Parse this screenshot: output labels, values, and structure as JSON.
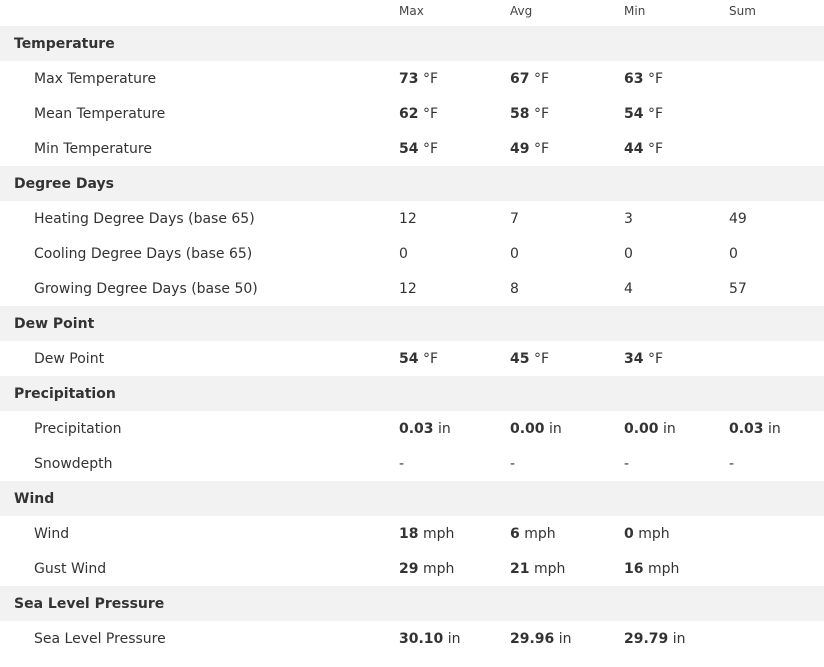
{
  "columns": {
    "max": "Max",
    "avg": "Avg",
    "min": "Min",
    "sum": "Sum"
  },
  "sections": [
    {
      "title": "Temperature",
      "rows": [
        {
          "label": "Max Temperature",
          "max": {
            "v": "73",
            "u": "°F",
            "b": true
          },
          "avg": {
            "v": "67",
            "u": "°F",
            "b": true
          },
          "min": {
            "v": "63",
            "u": "°F",
            "b": true
          },
          "sum": {
            "v": "",
            "u": "",
            "b": false
          }
        },
        {
          "label": "Mean Temperature",
          "max": {
            "v": "62",
            "u": "°F",
            "b": true
          },
          "avg": {
            "v": "58",
            "u": "°F",
            "b": true
          },
          "min": {
            "v": "54",
            "u": "°F",
            "b": true
          },
          "sum": {
            "v": "",
            "u": "",
            "b": false
          }
        },
        {
          "label": "Min Temperature",
          "max": {
            "v": "54",
            "u": "°F",
            "b": true
          },
          "avg": {
            "v": "49",
            "u": "°F",
            "b": true
          },
          "min": {
            "v": "44",
            "u": "°F",
            "b": true
          },
          "sum": {
            "v": "",
            "u": "",
            "b": false
          }
        }
      ]
    },
    {
      "title": "Degree Days",
      "rows": [
        {
          "label": "Heating Degree Days (base 65)",
          "max": {
            "v": "12",
            "u": "",
            "b": false
          },
          "avg": {
            "v": "7",
            "u": "",
            "b": false
          },
          "min": {
            "v": "3",
            "u": "",
            "b": false
          },
          "sum": {
            "v": "49",
            "u": "",
            "b": false
          }
        },
        {
          "label": "Cooling Degree Days (base 65)",
          "max": {
            "v": "0",
            "u": "",
            "b": false
          },
          "avg": {
            "v": "0",
            "u": "",
            "b": false
          },
          "min": {
            "v": "0",
            "u": "",
            "b": false
          },
          "sum": {
            "v": "0",
            "u": "",
            "b": false
          }
        },
        {
          "label": "Growing Degree Days (base 50)",
          "max": {
            "v": "12",
            "u": "",
            "b": false
          },
          "avg": {
            "v": "8",
            "u": "",
            "b": false
          },
          "min": {
            "v": "4",
            "u": "",
            "b": false
          },
          "sum": {
            "v": "57",
            "u": "",
            "b": false
          }
        }
      ]
    },
    {
      "title": "Dew Point",
      "rows": [
        {
          "label": "Dew Point",
          "max": {
            "v": "54",
            "u": "°F",
            "b": true
          },
          "avg": {
            "v": "45",
            "u": "°F",
            "b": true
          },
          "min": {
            "v": "34",
            "u": "°F",
            "b": true
          },
          "sum": {
            "v": "",
            "u": "",
            "b": false
          }
        }
      ]
    },
    {
      "title": "Precipitation",
      "rows": [
        {
          "label": "Precipitation",
          "max": {
            "v": "0.03",
            "u": "in",
            "b": true
          },
          "avg": {
            "v": "0.00",
            "u": "in",
            "b": true
          },
          "min": {
            "v": "0.00",
            "u": "in",
            "b": true
          },
          "sum": {
            "v": "0.03",
            "u": "in",
            "b": true
          }
        },
        {
          "label": "Snowdepth",
          "max": {
            "v": "-",
            "u": "",
            "b": false
          },
          "avg": {
            "v": "-",
            "u": "",
            "b": false
          },
          "min": {
            "v": "-",
            "u": "",
            "b": false
          },
          "sum": {
            "v": "-",
            "u": "",
            "b": false
          }
        }
      ]
    },
    {
      "title": "Wind",
      "rows": [
        {
          "label": "Wind",
          "max": {
            "v": "18",
            "u": "mph",
            "b": true
          },
          "avg": {
            "v": "6",
            "u": "mph",
            "b": true
          },
          "min": {
            "v": "0",
            "u": "mph",
            "b": true
          },
          "sum": {
            "v": "",
            "u": "",
            "b": false
          }
        },
        {
          "label": "Gust Wind",
          "max": {
            "v": "29",
            "u": "mph",
            "b": true
          },
          "avg": {
            "v": "21",
            "u": "mph",
            "b": true
          },
          "min": {
            "v": "16",
            "u": "mph",
            "b": true
          },
          "sum": {
            "v": "",
            "u": "",
            "b": false
          }
        }
      ]
    },
    {
      "title": "Sea Level Pressure",
      "rows": [
        {
          "label": "Sea Level Pressure",
          "max": {
            "v": "30.10",
            "u": "in",
            "b": true
          },
          "avg": {
            "v": "29.96",
            "u": "in",
            "b": true
          },
          "min": {
            "v": "29.79",
            "u": "in",
            "b": true
          },
          "sum": {
            "v": "",
            "u": "",
            "b": false
          }
        }
      ]
    }
  ]
}
